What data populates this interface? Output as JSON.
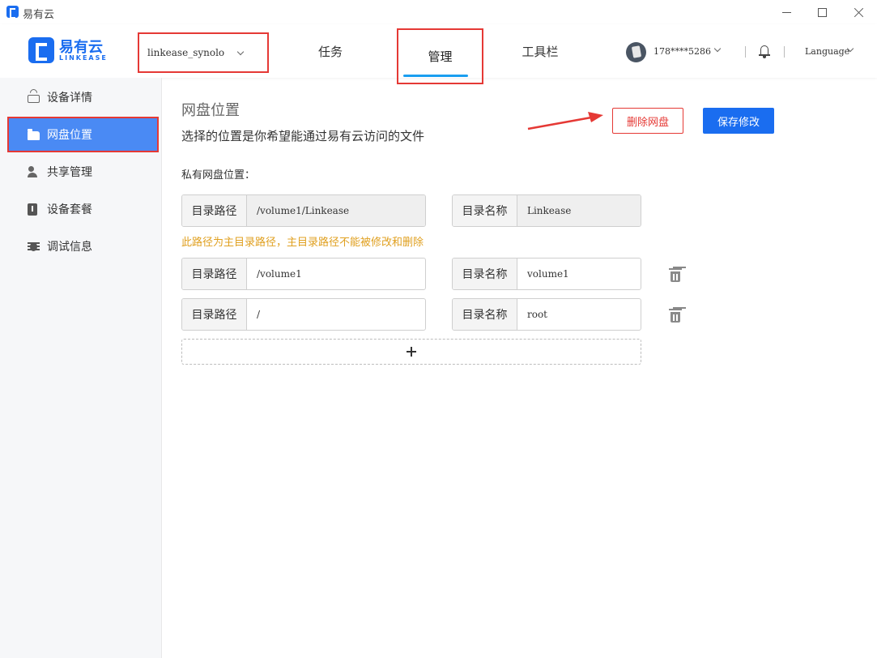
{
  "window": {
    "title": "易有云"
  },
  "header": {
    "logo_name": "易有云",
    "logo_sub": "LINKEASE",
    "device_select": "linkease_synolo",
    "tabs": [
      {
        "label": "任务"
      },
      {
        "label": "管理"
      },
      {
        "label": "工具栏"
      }
    ],
    "active_tab": "管理",
    "account": "178****5286",
    "language": "Language"
  },
  "sidebar": {
    "items": [
      {
        "label": "设备详情",
        "icon": "router-icon"
      },
      {
        "label": "网盘位置",
        "icon": "folder-open-icon"
      },
      {
        "label": "共享管理",
        "icon": "users-icon"
      },
      {
        "label": "设备套餐",
        "icon": "plan-icon"
      },
      {
        "label": "调试信息",
        "icon": "bug-icon"
      }
    ],
    "active": "网盘位置"
  },
  "main": {
    "title": "网盘位置",
    "subtitle": "选择的位置是你希望能通过易有云访问的文件",
    "delete_button": "删除网盘",
    "save_button": "保存修改",
    "section_label": "私有网盘位置：",
    "path_label": "目录路径",
    "name_label": "目录名称",
    "hint": "此路径为主目录路径，主目录路径不能被修改和删除",
    "rows": [
      {
        "path": "/volume1/Linkease",
        "name": "Linkease",
        "readonly": true
      },
      {
        "path": "/volume1",
        "name": "volume1",
        "readonly": false
      },
      {
        "path": "/",
        "name": "root",
        "readonly": false
      }
    ]
  },
  "colors": {
    "accent": "#1a6df0",
    "highlight_border": "#e53935",
    "hint": "#e0a020",
    "sidebar_active": "#4a8af4"
  }
}
